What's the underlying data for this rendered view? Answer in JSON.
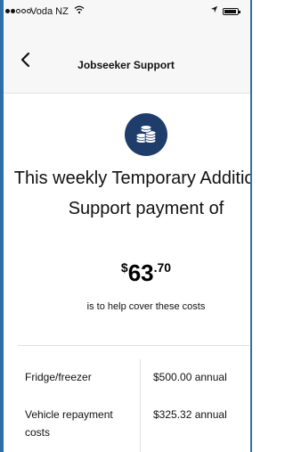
{
  "status_bar": {
    "signal": "full-full-empty-empty-empty",
    "carrier": "Voda NZ",
    "wifi_icon": "wifi-icon",
    "location_icon": "location-arrow-icon",
    "battery_icon": "battery-icon"
  },
  "nav": {
    "back_icon": "chevron-left-icon",
    "title": "Jobseeker Support"
  },
  "badge": {
    "icon": "coins-icon",
    "color": "#1f3d6b"
  },
  "headline": "This weekly Temporary Additional Support payment of",
  "payment": {
    "currency": "$",
    "dollars": "63",
    "cents": ".70"
  },
  "subtext": "is to help cover these costs",
  "costs": [
    {
      "label": "Fridge/freezer",
      "amount": "$500.00 annual"
    },
    {
      "label": "Vehicle repayment costs",
      "amount": "$325.32 annual"
    }
  ],
  "colors": {
    "frame": "#2d6fa8",
    "header_bg": "#f7f7f7",
    "text": "#111111"
  }
}
